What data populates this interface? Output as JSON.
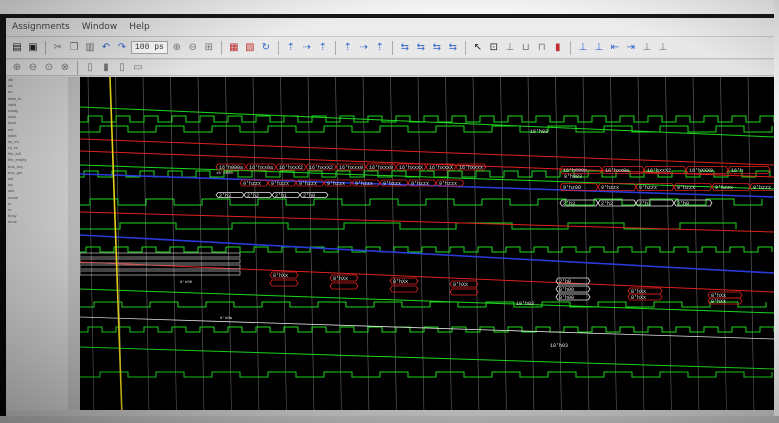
{
  "menu": [
    "Assignments",
    "Window",
    "Help"
  ],
  "toolbar": {
    "zoom_value": "100 ps",
    "buttons": [
      "open-icon",
      "save-icon",
      "cut-icon",
      "copy-icon",
      "paste-icon",
      "undo-icon",
      "redo-icon",
      "find-icon",
      "zoom-in-icon",
      "zoom-out-icon",
      "zoom-fit-icon",
      "run-icon",
      "step-icon",
      "restart-icon",
      "break-icon",
      "cursor-icon",
      "add-marker-icon",
      "prev-edge-icon",
      "next-edge-icon",
      "wave-add-icon",
      "wave-remove-icon"
    ]
  },
  "signal_names": [
    "clk",
    "rst",
    "en",
    "data_in",
    "valid",
    "ready",
    "addr",
    "dout",
    "cnt",
    "state",
    "wr_en",
    "rd_en",
    "fifo_full",
    "fifo_empty",
    "bus_req",
    "bus_gnt",
    "sel",
    "irq",
    "ack",
    "mode",
    "tx",
    "rx",
    "busy",
    "done"
  ],
  "colors": {
    "green": "#1ed81e",
    "red": "#e02020",
    "blue": "#2a3ad8",
    "white": "#e8e8e8",
    "cursor": "#e8d21a"
  },
  "cursor_time": "0 ns",
  "bus_labels": {
    "top_hex": "16'h03",
    "row_a": [
      "16'h000a",
      "16'hxx0a",
      "16'hxxX2",
      "16'hxxX2",
      "16'hxxx0",
      "16'hxxx0",
      "16'hxxxX",
      "16'hxxxX",
      "16'hxxxx"
    ],
    "row_a_right": [
      "16'h000a",
      "16'hxx0a",
      "16'hxxX2",
      "16'hXXX0",
      "16'h"
    ],
    "row_b_small": "16'h000",
    "row_b_right": "9'h003",
    "row_c": [
      "9'hzzx",
      "9'hzzx",
      "9'hzzx",
      "9'hzzx",
      "9'hzzx",
      "9'hzzx",
      "9'hzzx",
      "9'hzzx"
    ],
    "row_c_right": [
      "9'hz00",
      "9'hzzx",
      "9'hzzx",
      "9'hzzx",
      "9'hzzx",
      "9'hzzx"
    ],
    "row_d": [
      "2'h3",
      "2'h2",
      "2'h1",
      "2'h0"
    ],
    "row_d_right": [
      "2'h3",
      "2'h2",
      "2'h1",
      "2'h0"
    ],
    "low_left": "8'h00",
    "low_pairs": [
      "8'hXx",
      "8'hXx",
      "8'hXx",
      "8'hXx"
    ],
    "low_right": [
      "2'h0",
      "8'h00",
      "8'h00"
    ],
    "low_far": [
      "8'hXx",
      "8'hXx",
      "8'hXx",
      "8'hXx"
    ],
    "mid_h03": "18'h03",
    "bottom_h03": "18'h03",
    "bottom_bus": "8'h0a"
  }
}
